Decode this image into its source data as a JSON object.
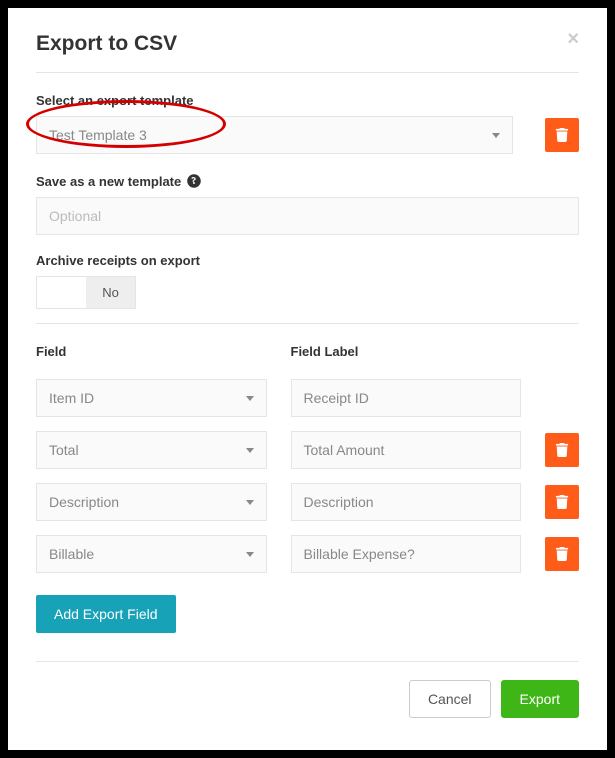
{
  "modal": {
    "title": "Export to CSV",
    "template_label": "Select an export template",
    "template_value": "Test Template 3",
    "save_label": "Save as a new template",
    "save_placeholder": "Optional",
    "archive_label": "Archive receipts on export",
    "toggle_no": "No",
    "field_header": "Field",
    "label_header": "Field Label",
    "add_button": "Add Export Field",
    "cancel": "Cancel",
    "export": "Export"
  },
  "fields": [
    {
      "field": "Item ID",
      "label": "Receipt ID",
      "deletable": false
    },
    {
      "field": "Total",
      "label": "Total Amount",
      "deletable": true
    },
    {
      "field": "Description",
      "label": "Description",
      "deletable": true
    },
    {
      "field": "Billable",
      "label": "Billable Expense?",
      "deletable": true
    }
  ]
}
